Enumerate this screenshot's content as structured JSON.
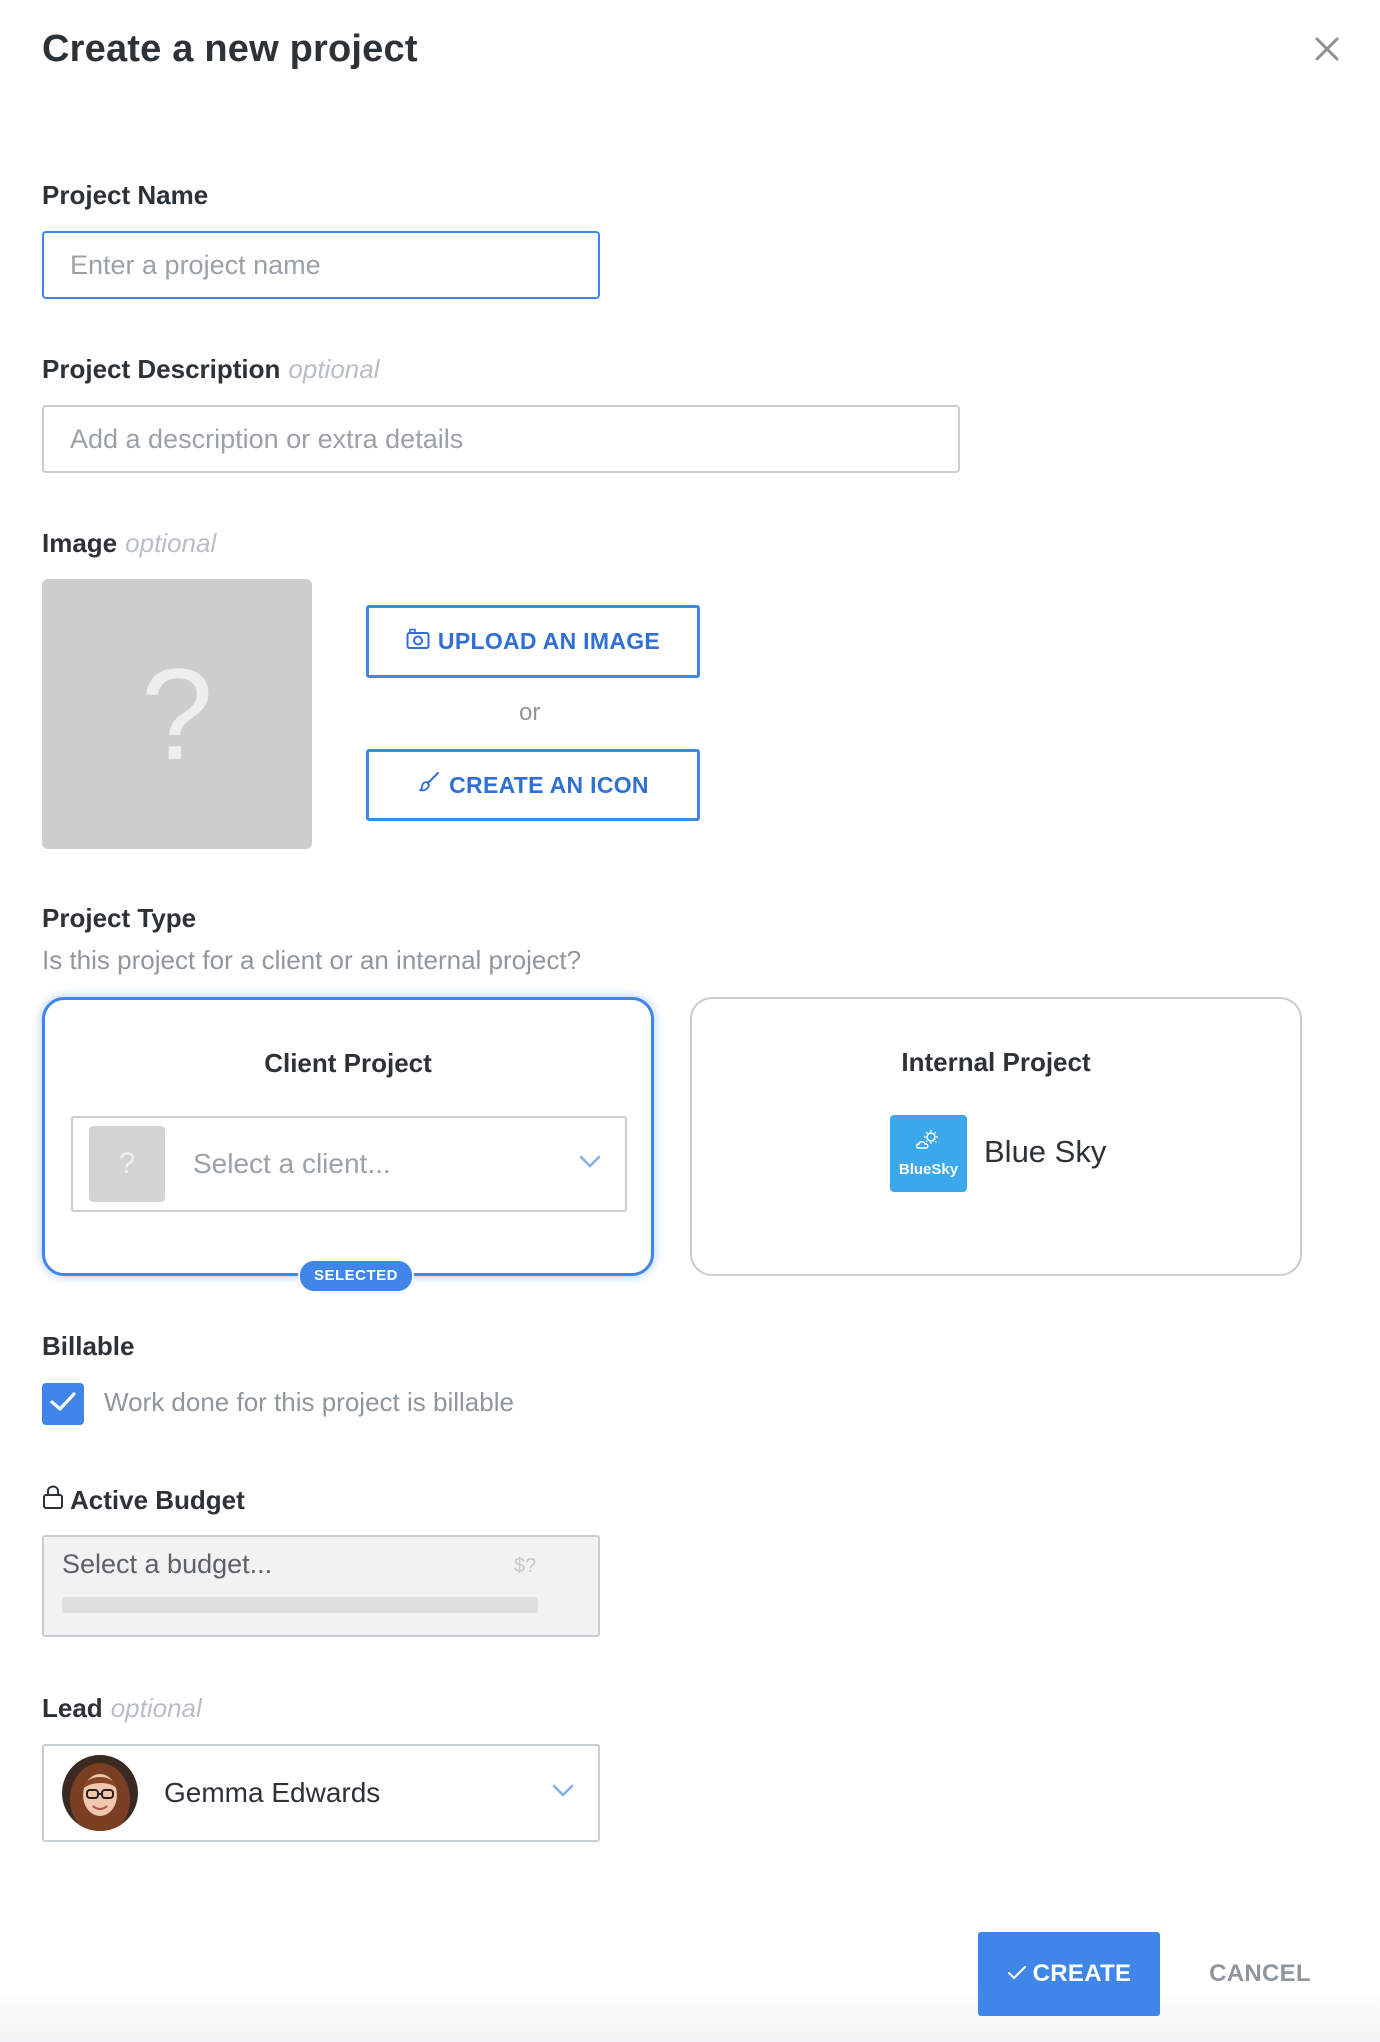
{
  "modal": {
    "title": "Create a new project"
  },
  "project_name": {
    "label": "Project Name",
    "placeholder": "Enter a project name",
    "value": ""
  },
  "project_description": {
    "label": "Project Description",
    "optional": "optional",
    "placeholder": "Add a description or extra details",
    "value": ""
  },
  "image": {
    "label": "Image",
    "optional": "optional",
    "placeholder_glyph": "?",
    "upload_label": "UPLOAD AN IMAGE",
    "upload_icon": "camera-icon",
    "or_text": "or",
    "create_icon_label": "CREATE AN ICON",
    "create_icon_icon": "paintbrush-icon"
  },
  "project_type": {
    "label": "Project Type",
    "subtitle": "Is this project for a client or an internal project?",
    "client": {
      "title": "Client Project",
      "select_placeholder": "Select a client...",
      "avatar_glyph": "?",
      "badge": "SELECTED",
      "selected": true
    },
    "internal": {
      "title": "Internal Project",
      "org_name": "Blue Sky",
      "logo_text": "BlueSky",
      "logo_icon": "sun-cloud-icon",
      "selected": false
    }
  },
  "billable": {
    "label": "Billable",
    "checkbox_label": "Work done for this project is billable",
    "checked": true
  },
  "active_budget": {
    "label": "Active Budget",
    "icon": "lock-icon",
    "placeholder": "Select a budget...",
    "currency_hint": "$?"
  },
  "lead": {
    "label": "Lead",
    "optional": "optional",
    "value": "Gemma Edwards"
  },
  "actions": {
    "create_label": "CREATE",
    "cancel_label": "CANCEL"
  },
  "colors": {
    "accent": "#3f86e8",
    "border": "#c8cdd1",
    "placeholder": "#9aa1a7",
    "muted": "#8f969c",
    "logo_bg": "#3aa8ea"
  }
}
